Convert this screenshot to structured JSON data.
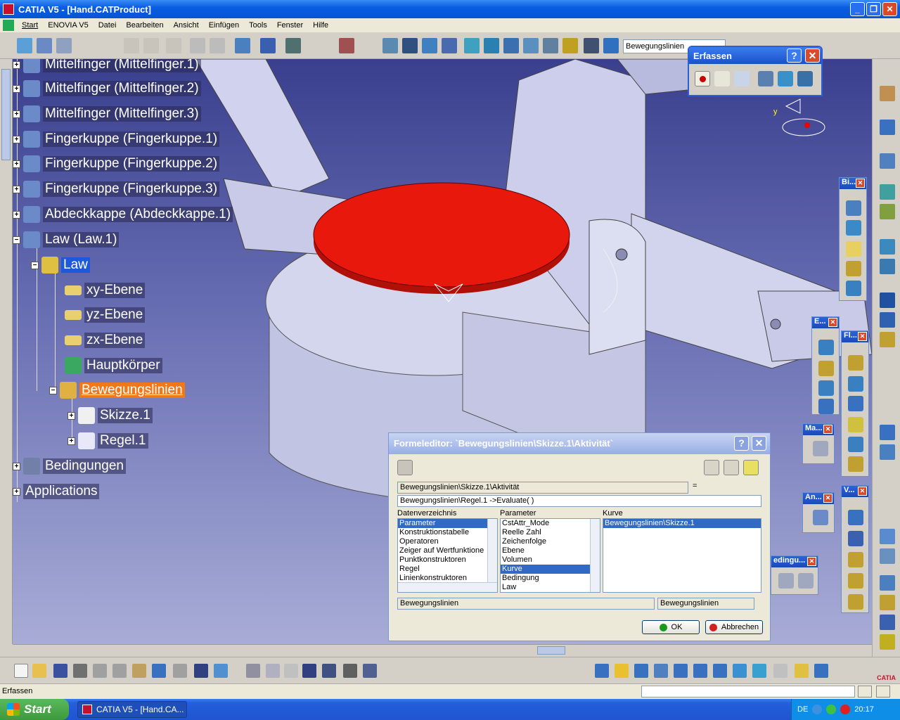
{
  "window": {
    "title": "CATIA V5 - [Hand.CATProduct]",
    "controls": {
      "minimize": "_",
      "restore": "❐",
      "close": "✕"
    }
  },
  "menu": {
    "items": [
      "Start",
      "ENOVIA V5",
      "Datei",
      "Bearbeiten",
      "Ansicht",
      "Einfügen",
      "Tools",
      "Fenster",
      "Hilfe"
    ]
  },
  "toolbar": {
    "name_field": "Bewegungslinien"
  },
  "tree": {
    "items": [
      {
        "label": "Mittelfinger (Mittelfinger.1)"
      },
      {
        "label": "Mittelfinger (Mittelfinger.2)"
      },
      {
        "label": "Mittelfinger (Mittelfinger.3)"
      },
      {
        "label": "Fingerkuppe (Fingerkuppe.1)"
      },
      {
        "label": "Fingerkuppe (Fingerkuppe.2)"
      },
      {
        "label": "Fingerkuppe (Fingerkuppe.3)"
      },
      {
        "label": "Abdeckkappe (Abdeckkappe.1)"
      },
      {
        "label": "Law (Law.1)"
      },
      {
        "label": "Law"
      },
      {
        "label": "xy-Ebene"
      },
      {
        "label": "yz-Ebene"
      },
      {
        "label": "zx-Ebene"
      },
      {
        "label": "Hauptkörper"
      },
      {
        "label": "Bewegungslinien"
      },
      {
        "label": "Skizze.1"
      },
      {
        "label": "Regel.1"
      },
      {
        "label": "Bedingungen"
      },
      {
        "label": "Applications"
      }
    ]
  },
  "erfassen": {
    "title": "Erfassen",
    "help": "?",
    "close": "✕"
  },
  "float_toolbars": {
    "bi": "Bi...",
    "e": "E...",
    "fl": "Fl...",
    "ma": "Ma...",
    "an": "An...",
    "v": "V...",
    "bedingu": "edingu..."
  },
  "compass": {
    "axis_label": "y"
  },
  "dialog": {
    "title": "Formeleditor:  `Bewegungslinien\\Skizze.1\\Aktivität`",
    "help": "?",
    "close": "✕",
    "target_field": "Bewegungslinien\\Skizze.1\\Aktivität",
    "equals": "=",
    "formula_field": "Bewegungslinien\\Regel.1 ->Evaluate( )",
    "col1_header": "Datenverzeichnis",
    "col2_header": "Parameter",
    "col3_header": "Kurve",
    "col1_items": [
      "Parameter",
      "Konstruktionstabelle",
      "Operatoren",
      "Zeiger auf Wertfunktione",
      "Punktkonstruktoren",
      "Regel",
      "Linienkonstruktoren"
    ],
    "col2_items": [
      "CstAttr_Mode",
      "Reelle Zahl",
      "Zeichenfolge",
      "Ebene",
      "Volumen",
      "Kurve",
      "Bedingung",
      "Law"
    ],
    "col3_items": [
      "Bewegungslinien\\Skizze.1"
    ],
    "bottom_left": "Bewegungslinien",
    "bottom_right": "Bewegungslinien",
    "ok": "OK",
    "cancel": "Abbrechen"
  },
  "statusbar": {
    "text": "Erfassen"
  },
  "taskbar": {
    "start": "Start",
    "task_item": "CATIA V5 - [Hand.CA...",
    "lang": "DE",
    "clock": "20:17"
  },
  "brand": {
    "logo_text": "CATIA"
  },
  "colors": {
    "accent": "#0554d6",
    "selection": "#316ac5",
    "active_node": "#f07818",
    "red_part": "#e8180c",
    "viewport_top": "#3a3f8e",
    "viewport_bottom": "#a8acd6"
  }
}
